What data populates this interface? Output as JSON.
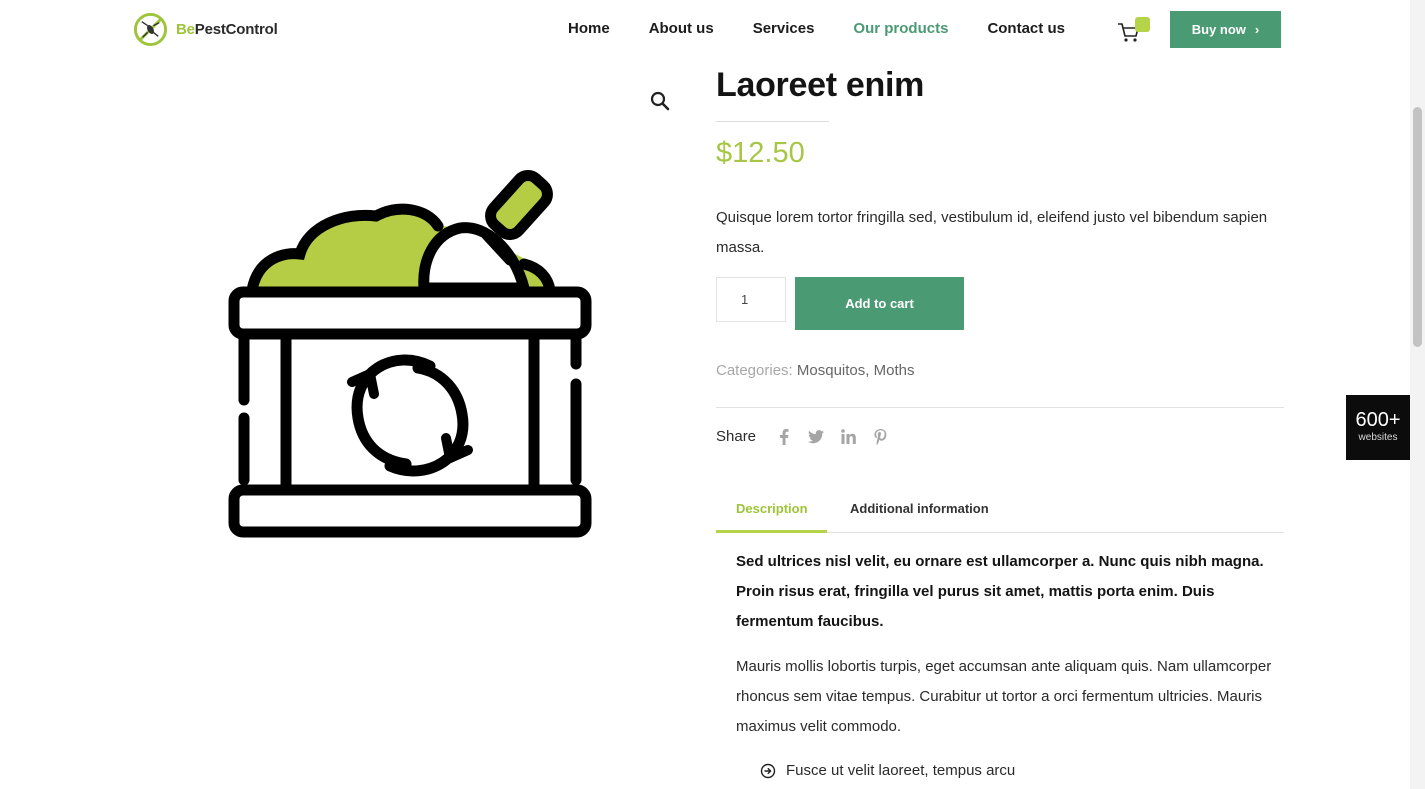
{
  "header": {
    "logo_prefix": "Be",
    "logo_name": "PestControl",
    "nav": [
      {
        "label": "Home",
        "active": false
      },
      {
        "label": "About us",
        "active": false
      },
      {
        "label": "Services",
        "active": false
      },
      {
        "label": "Our products",
        "active": true
      },
      {
        "label": "Contact us",
        "active": false
      }
    ],
    "buy_label": "Buy now",
    "buy_chevron": "›"
  },
  "gallery": {
    "zoom_icon": "magnifier-icon",
    "image_icon": "compost-bin-icon"
  },
  "product": {
    "title": "Laoreet enim",
    "price": "$12.50",
    "short_description": "Quisque lorem tortor fringilla sed, vestibulum id, eleifend justo vel bibendum sapien massa.",
    "quantity": "1",
    "add_to_cart": "Add to cart",
    "categories_label": "Categories:",
    "categories": [
      "Mosquitos",
      "Moths"
    ],
    "category_separator": ",",
    "share_label": "Share",
    "share_icons": [
      "facebook-icon",
      "twitter-icon",
      "linkedin-icon",
      "pinterest-icon"
    ]
  },
  "tabs": [
    {
      "label": "Description",
      "active": true
    },
    {
      "label": "Additional information",
      "active": false
    }
  ],
  "description": {
    "lead": "Sed ultrices nisl velit, eu ornare est ullamcorper a. Nunc quis nibh magna. Proin risus erat, fringilla vel purus sit amet, mattis porta enim. Duis fermentum faucibus.",
    "body": "Mauris mollis lobortis turpis, eget accumsan ante aliquam quis. Nam ullamcorper rhoncus sem vitae tempus. Curabitur ut tortor a orci fermentum ultricies. Mauris maximus velit commodo.",
    "bullets": [
      "Fusce ut velit laoreet, tempus arcu"
    ]
  },
  "floating_badge": {
    "count": "600+",
    "caption": "websites"
  },
  "colors": {
    "brand_green": "#4a9a73",
    "accent_lime": "#b5d44a",
    "price": "#a8c646"
  }
}
